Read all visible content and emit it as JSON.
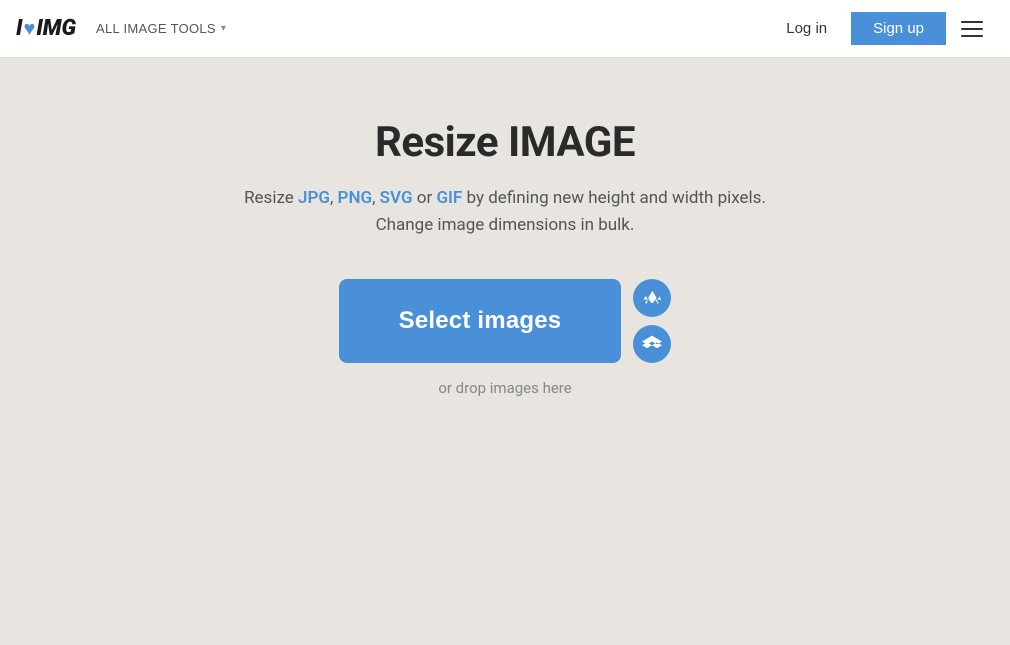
{
  "header": {
    "logo_i": "I",
    "logo_img": "IMG",
    "all_tools_label": "ALL IMAGE TOOLS",
    "login_label": "Log in",
    "signup_label": "Sign up"
  },
  "main": {
    "page_title": "Resize IMAGE",
    "subtitle_prefix": "Resize ",
    "format_jpg": "JPG",
    "comma1": ",",
    "format_png": "PNG",
    "comma2": ",",
    "format_svg": "SVG",
    "or_text": " or ",
    "format_gif": "GIF",
    "subtitle_suffix": " by defining new height and width pixels.",
    "subtitle_line2": "Change image dimensions in bulk.",
    "select_images_label": "Select images",
    "drop_text": "or drop images here"
  }
}
